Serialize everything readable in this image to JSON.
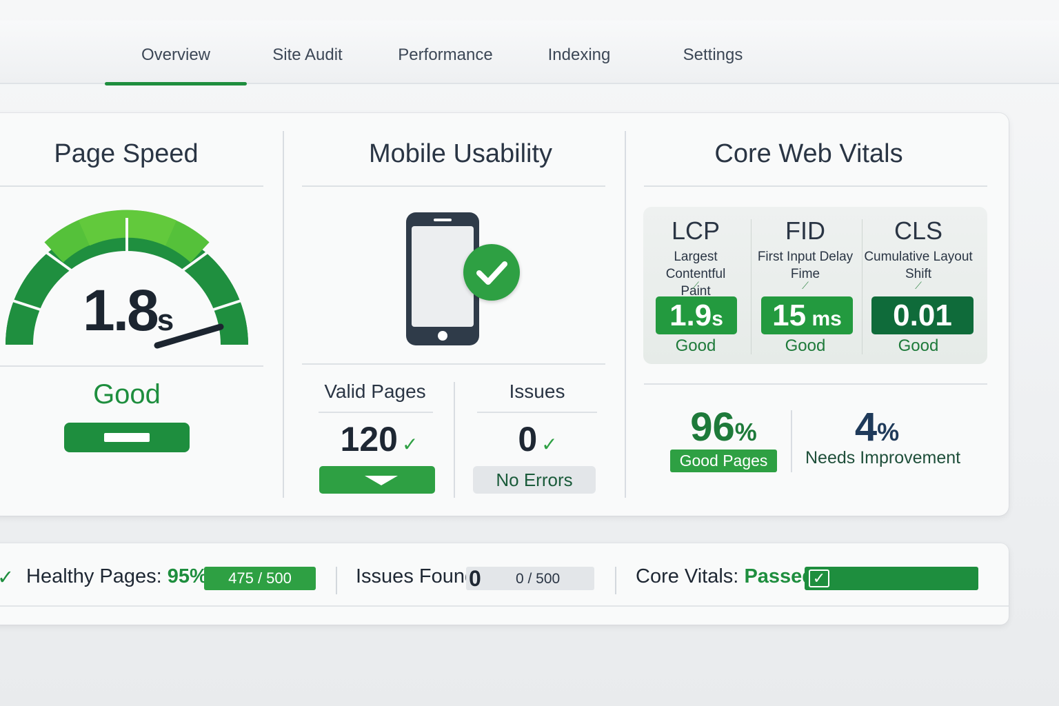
{
  "nav": {
    "tabs": [
      {
        "label": "Overview",
        "active": true
      },
      {
        "label": "Site Audit",
        "active": false
      },
      {
        "label": "Performance",
        "active": false
      },
      {
        "label": "Indexing",
        "active": false
      },
      {
        "label": "Settings",
        "active": false
      }
    ]
  },
  "page_speed": {
    "title": "Page Speed",
    "value": "1.8",
    "unit": "s",
    "status": "Good"
  },
  "mobile": {
    "title": "Mobile Usability",
    "valid_label": "Valid Pages",
    "valid_value": "120",
    "issues_label": "Issues",
    "issues_value": "0",
    "issues_status": "No Errors"
  },
  "vitals": {
    "title": "Core Web Vitals",
    "metrics": [
      {
        "abbr": "LCP",
        "desc_line1": "Largest Contentful",
        "desc_line2": "Paint",
        "value": "1.9",
        "unit": "s",
        "status": "Good"
      },
      {
        "abbr": "FID",
        "desc_line1": "First Input Delay",
        "desc_line2": "Fime",
        "value": "15",
        "unit": " ms",
        "status": "Good"
      },
      {
        "abbr": "CLS",
        "desc_line1": "Cumulative Layout",
        "desc_line2": "Shift",
        "value": "0.01",
        "unit": "",
        "status": "Good"
      }
    ],
    "good_pct": "96",
    "good_label": "Good Pages",
    "needs_pct": "4",
    "needs_label": "Needs Improvement"
  },
  "summary": {
    "healthy_label": "Healthy Pages:",
    "healthy_value": "95%",
    "healthy_count": "475 / 500",
    "issues_label": "Issues Found:",
    "issues_value": "0",
    "issues_count": "0 / 500",
    "vitals_label": "Core Vitals:",
    "vitals_value": "Passed"
  },
  "colors": {
    "accent": "#1e8e3e",
    "accent_light": "#2ea043",
    "dark_green": "#0f6b3a"
  }
}
